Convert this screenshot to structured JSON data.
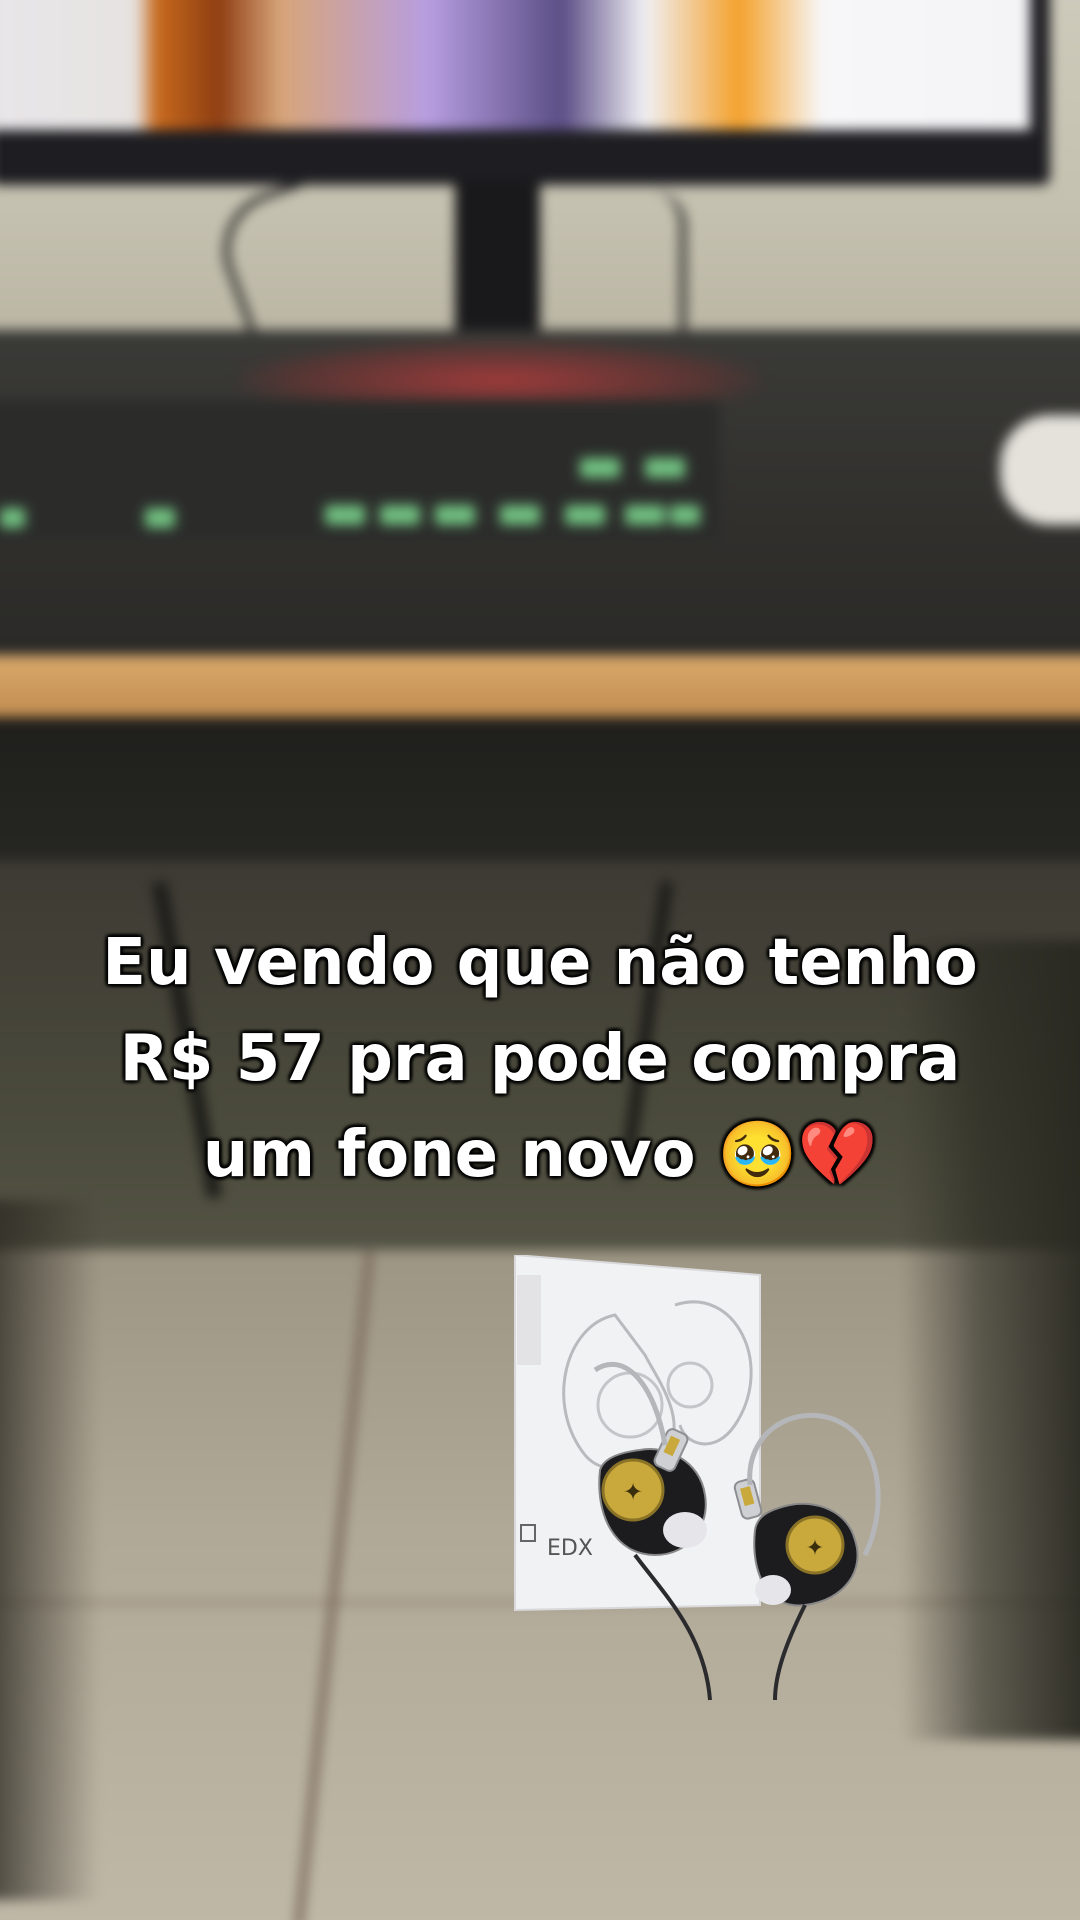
{
  "caption": {
    "line1": "Eu vendo que não tenho",
    "line2": "R$ 57 pra pode compra",
    "line3": "um fone novo 🥹💔"
  },
  "sticker": {
    "box_label": "EDX",
    "description": "in-ear earphones product image"
  }
}
